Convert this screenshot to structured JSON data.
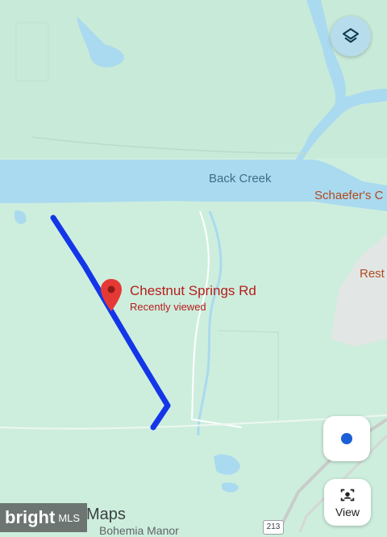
{
  "map": {
    "river_label": "Back Creek",
    "place_label": "Schaefer's C",
    "rest_label": "Rest",
    "maps_label": "Maps",
    "bottom_place": "Bohemia Manor",
    "highway_badge": "213"
  },
  "pin": {
    "title": "Chestnut Springs Rd",
    "subtitle": "Recently viewed",
    "icon": "map-pin-icon"
  },
  "controls": {
    "layers_icon": "layers-icon",
    "location_icon": "my-location-icon",
    "view_label": "View",
    "view_icon": "street-view-icon"
  },
  "watermark": {
    "brand": "bright",
    "suffix": "MLS"
  },
  "colors": {
    "land": "#cdeedd",
    "water": "#aadaf0",
    "route": "#1436e8",
    "pin": "#e53935",
    "urban": "#e6e6e6"
  }
}
